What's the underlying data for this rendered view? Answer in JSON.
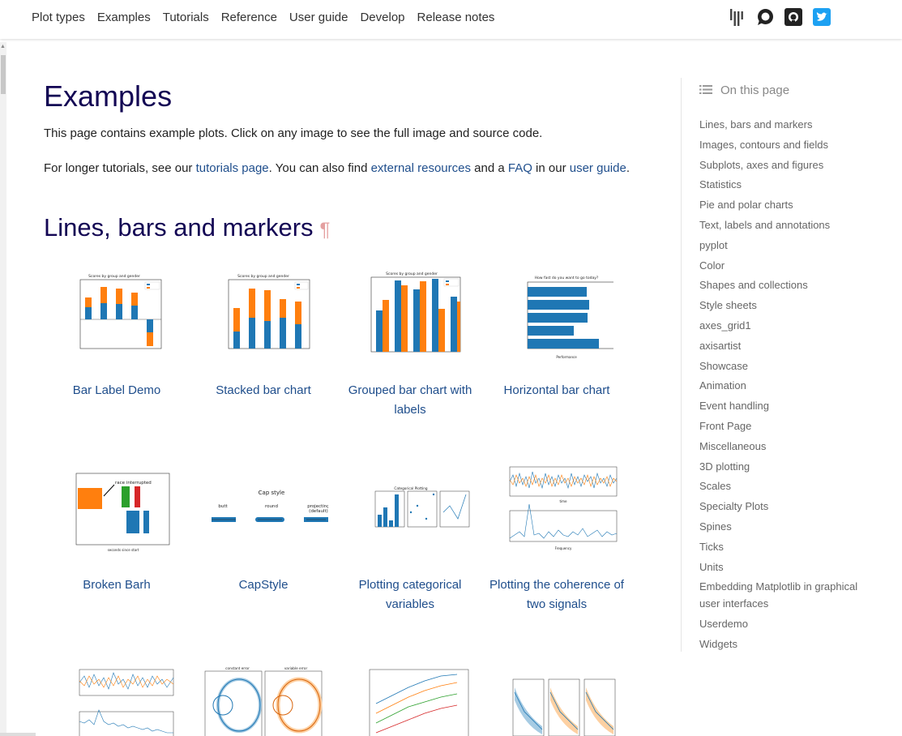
{
  "nav": {
    "links": [
      "Plot types",
      "Examples",
      "Tutorials",
      "Reference",
      "User guide",
      "Develop",
      "Release notes"
    ],
    "icons": [
      "gitter-icon",
      "discourse-icon",
      "github-icon",
      "twitter-icon"
    ]
  },
  "page": {
    "title": "Examples",
    "intro1": "This page contains example plots. Click on any image to see the full image and source code.",
    "intro2_pre": "For longer tutorials, see our ",
    "intro2_link1": "tutorials page",
    "intro2_mid1": ". You can also find ",
    "intro2_link2": "external resources",
    "intro2_mid2": " and a ",
    "intro2_link3": "FAQ",
    "intro2_mid3": " in our ",
    "intro2_link4": "user guide",
    "intro2_end": ".",
    "section_title": "Lines, bars and markers",
    "pilcrow": "¶"
  },
  "gallery": [
    {
      "caption": "Bar Label Demo"
    },
    {
      "caption": "Stacked bar chart"
    },
    {
      "caption": "Grouped bar chart with labels"
    },
    {
      "caption": "Horizontal bar chart"
    },
    {
      "caption": "Broken Barh"
    },
    {
      "caption": "CapStyle"
    },
    {
      "caption": "Plotting categorical variables"
    },
    {
      "caption": "Plotting the coherence of two signals"
    }
  ],
  "thumb_text": {
    "bar_label_title": "Scores by group and gender",
    "stacked_title": "Scores by group and gender",
    "grouped_title": "Scores by group and gender",
    "hbar_title": "How fast do you want to go today?",
    "hbar_xlabel": "Performance",
    "legend_men": "Men",
    "legend_women": "Women",
    "barh_annotation": "race interrupted",
    "barh_xlabel": "seconds since start",
    "capstyle_title": "Cap style",
    "cap_butt": "butt",
    "cap_round": "round",
    "cap_projecting": "projecting",
    "cap_default": "(default)",
    "categorical_title": "Categorical Plotting",
    "coherence_xlabel_top": "time",
    "coherence_xlabel_bottom": "Frequency",
    "row3_constant": "constant error",
    "row3_variable": "variable error"
  },
  "toc": {
    "header": "On this page",
    "items": [
      "Lines, bars and markers",
      "Images, contours and fields",
      "Subplots, axes and figures",
      "Statistics",
      "Pie and polar charts",
      "Text, labels and annotations",
      "pyplot",
      "Color",
      "Shapes and collections",
      "Style sheets",
      "axes_grid1",
      "axisartist",
      "Showcase",
      "Animation",
      "Event handling",
      "Front Page",
      "Miscellaneous",
      "3D plotting",
      "Scales",
      "Specialty Plots",
      "Spines",
      "Ticks",
      "Units",
      "Embedding Matplotlib in graphical user interfaces",
      "Userdemo",
      "Widgets"
    ]
  },
  "colors": {
    "heading": "#130654",
    "link": "#1f4e8c",
    "mpl_blue": "#1f77b4",
    "mpl_orange": "#ff7f0e"
  }
}
